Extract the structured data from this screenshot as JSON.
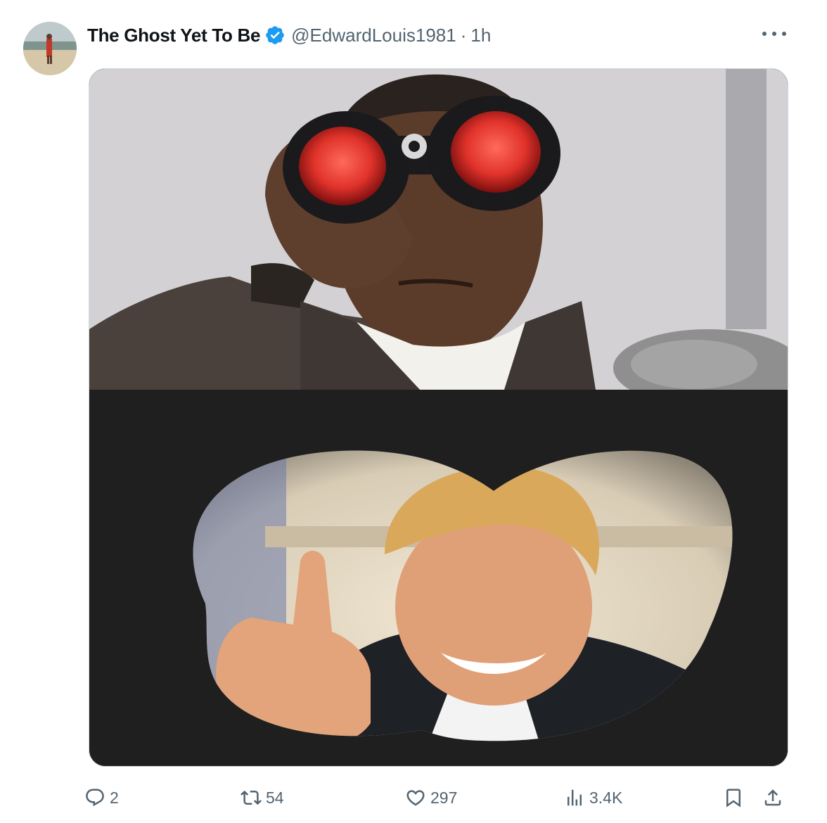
{
  "post": {
    "author": {
      "display_name": "The Ghost Yet To Be",
      "handle": "@EdwardLouis1981",
      "time": "1h",
      "separator": "·",
      "verified": true,
      "verified_color": "#1d9bf0"
    },
    "media": {
      "panels": [
        "man-with-red-binoculars",
        "binocular-view-middle-finger"
      ]
    },
    "actions": {
      "replies": "2",
      "reposts": "54",
      "likes": "297",
      "views": "3.4K"
    }
  },
  "colors": {
    "text_primary": "#0f1419",
    "text_secondary": "#536471",
    "border": "#cfd9de"
  }
}
